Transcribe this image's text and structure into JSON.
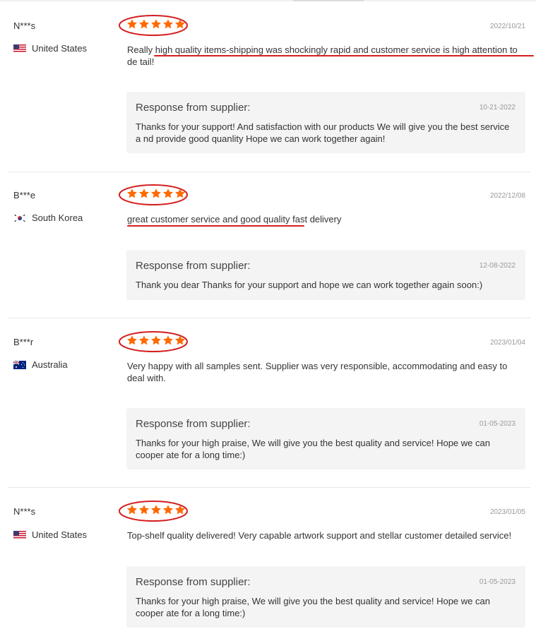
{
  "reviews": [
    {
      "reviewer": "N***s",
      "country": "United States",
      "flag": "us-flag-icon",
      "rating": 5,
      "date": "2022/10/21",
      "comment": "Really high quality items-shipping was shockingly rapid and customer service is high attention to de tail!",
      "response_title": "Response from supplier:",
      "response_date": "10-21-2022",
      "response_text": "Thanks for your support! And satisfaction with our products We will give you the best service a nd provide good quanlity Hope we can work together again!"
    },
    {
      "reviewer": "B***e",
      "country": "South Korea",
      "flag": "kr-flag-icon",
      "rating": 5,
      "date": "2022/12/08",
      "comment": "great customer service and good quality fast delivery",
      "response_title": "Response from supplier:",
      "response_date": "12-08-2022",
      "response_text": "Thank you dear Thanks for your support and hope we can work together again soon:)"
    },
    {
      "reviewer": "B***r",
      "country": "Australia",
      "flag": "au-flag-icon",
      "rating": 5,
      "date": "2023/01/04",
      "comment": "Very happy with all samples sent. Supplier was very responsible, accommodating and easy to deal with.",
      "response_title": "Response from supplier:",
      "response_date": "01-05-2023",
      "response_text": "Thanks for your high praise, We will give you the best quality and service! Hope we can cooper ate for a long time:)"
    },
    {
      "reviewer": "N***s",
      "country": "United States",
      "flag": "us-flag-icon",
      "rating": 5,
      "date": "2023/01/05",
      "comment": "Top-shelf quality delivered! Very capable artwork support and stellar customer detailed service!",
      "response_title": "Response from supplier:",
      "response_date": "01-05-2023",
      "response_text": "Thanks for your high praise, We will give you the best quality and service! Hope we can cooper ate for a long time:)"
    }
  ],
  "colors": {
    "star": "#ff6a00",
    "annotation": "#d41f1f",
    "response_bg": "#f4f4f4"
  }
}
